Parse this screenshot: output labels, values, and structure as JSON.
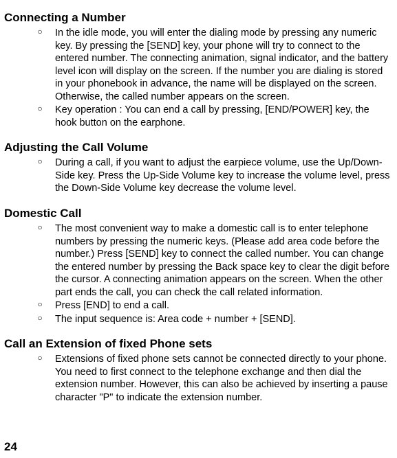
{
  "sections": [
    {
      "heading": "Connecting a Number",
      "items": [
        "In the idle mode, you will enter the dialing mode by pressing any numeric key. By pressing the [SEND] key, your phone will try to connect to the entered number. The connecting animation, signal indicator, and the battery level icon will display on the screen. If the number you are dialing is stored in your phonebook in advance, the name will be displayed on the screen. Otherwise, the called number appears on the screen.",
        "Key operation : You can end a call by pressing, [END/POWER] key, the hook button on the earphone."
      ]
    },
    {
      "heading": "Adjusting the Call Volume",
      "items": [
        "During a call, if you want to adjust the earpiece volume, use the Up/Down-Side key. Press the Up-Side Volume key to increase the volume level, press the Down-Side Volume key decrease the volume level."
      ]
    },
    {
      "heading": "Domestic Call",
      "items": [
        "The most convenient way to make a domestic call is to enter telephone numbers by pressing the numeric keys. (Please add area code before the number.) Press [SEND] key to connect the called number. You can change the entered number by pressing the Back space key to clear the digit before the cursor. A connecting animation appears on the screen. When the other part ends the call, you can check the call related information.",
        "Press [END] to end a call.",
        "The input sequence is:    Area code + number + [SEND]."
      ]
    },
    {
      "heading": "Call an Extension of fixed Phone sets",
      "items": [
        "Extensions of fixed phone sets cannot be connected directly to your phone. You need to first connect to the telephone exchange and then dial the extension number. However, this can also be achieved by inserting a pause character \"P\" to indicate the extension number."
      ]
    }
  ],
  "page_number": "24",
  "bullet_glyph": "○"
}
